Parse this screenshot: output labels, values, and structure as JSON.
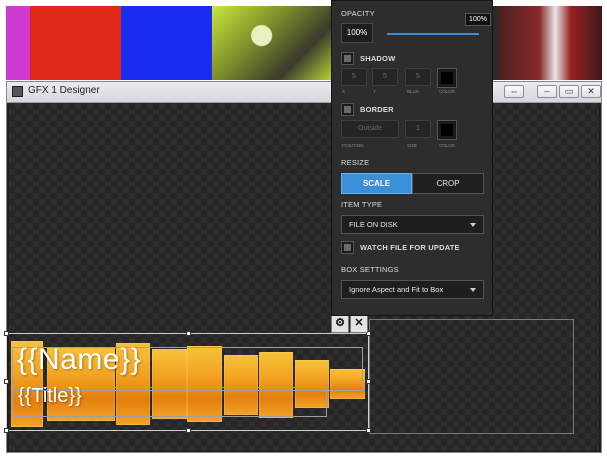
{
  "window": {
    "title": "GFX 1 Designer",
    "buttons": {
      "swap": "⇔",
      "minimize": "–",
      "maximize": "▭",
      "close": "✕"
    }
  },
  "panel": {
    "opacity": {
      "label": "OPACITY",
      "value": "100%",
      "slider_tip": "100%",
      "slider_fraction": 1.0
    },
    "shadow": {
      "label": "SHADOW",
      "checked": true,
      "x": "5",
      "y": "5",
      "blur": "5",
      "x_label": "X",
      "y_label": "Y",
      "blur_label": "BLUR",
      "color_label": "COLOR",
      "color": "#000000"
    },
    "border": {
      "label": "BORDER",
      "checked": true,
      "position_placeholder": "Outside",
      "size": "1",
      "position_label": "POSITION",
      "size_label": "SIZE",
      "color_label": "COLOR",
      "color": "#000000"
    },
    "resize": {
      "label": "RESIZE",
      "options": [
        "SCALE",
        "CROP"
      ],
      "selected": "SCALE"
    },
    "item_type": {
      "label": "ITEM TYPE",
      "value": "FILE ON DISK"
    },
    "watch": {
      "label": "WATCH FILE FOR UPDATE",
      "checked": true
    },
    "box_settings": {
      "label": "BOX SETTINGS",
      "value": "Ignore Aspect and Fit to Box"
    }
  },
  "graphic": {
    "name_placeholder": "{{Name}}",
    "title_placeholder": "{{Title}}"
  },
  "tools": {
    "settings_icon": "gear-icon",
    "close_icon": "close-icon"
  },
  "colors": {
    "accent": "#3a8fd8",
    "gfx_orange": "#f4a623",
    "panel_bg": "#2d2d2d",
    "video_bars": [
      "#d03ad0",
      "#e02818",
      "#1a2cf0"
    ]
  }
}
